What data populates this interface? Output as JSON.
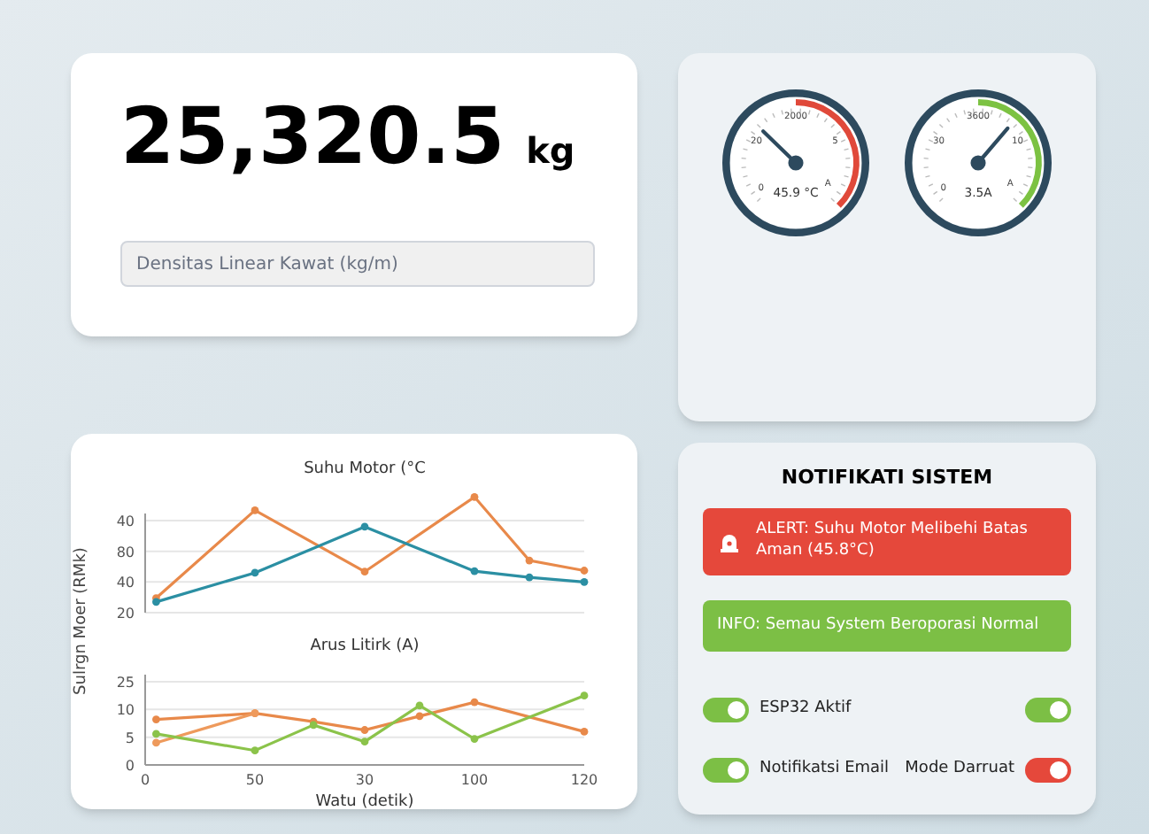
{
  "weight": {
    "value": "25,320.5",
    "unit": "kg"
  },
  "density_field": {
    "placeholder": "Densitas Linear Kawat (kg/m)"
  },
  "gauges": [
    {
      "scale": [
        "0",
        "20",
        "2000",
        "5",
        "A"
      ],
      "reading": "45.9 °C",
      "level": 0.33,
      "color": "#e0493a"
    },
    {
      "scale": [
        "0",
        "30",
        "3600",
        "10",
        "A"
      ],
      "reading": "3.5A",
      "level": 0.65,
      "color": "#7cc242"
    }
  ],
  "chart_panel": {
    "y_axis_label": "Sulrgn Moer (RMk)",
    "charts": [
      {
        "title": "Suhu Motor (°C",
        "yticks": [
          "40",
          "80",
          "40",
          "20"
        ]
      },
      {
        "title": "Arus Litirk (A)",
        "yticks": [
          "25",
          "10",
          "5",
          "0"
        ],
        "xticks": [
          "0",
          "50",
          "30",
          "100",
          "120"
        ],
        "xlabel": "Watu (detik)"
      }
    ]
  },
  "notifications": {
    "title": "NOTIFIKATI SISTEM",
    "messages": [
      {
        "kind": "alert",
        "text": "ALERT: Suhu Motor Melibehi Batas Aman (45.8°C)",
        "color": "#e5483b"
      },
      {
        "kind": "info",
        "text": "INFO: Semau System Beroporasi Normal",
        "color": "#7cbf45"
      }
    ],
    "toggles": [
      {
        "label": "ESP32 Aktif",
        "on": true,
        "color": "#7cbf45"
      },
      {
        "on": true,
        "color": "#7cbf45"
      },
      {
        "label": "Notifikatsi Email",
        "on": true,
        "color": "#7cbf45"
      },
      {
        "label": "Mode Darruat",
        "on": true,
        "color": "#e5483b"
      }
    ]
  }
}
